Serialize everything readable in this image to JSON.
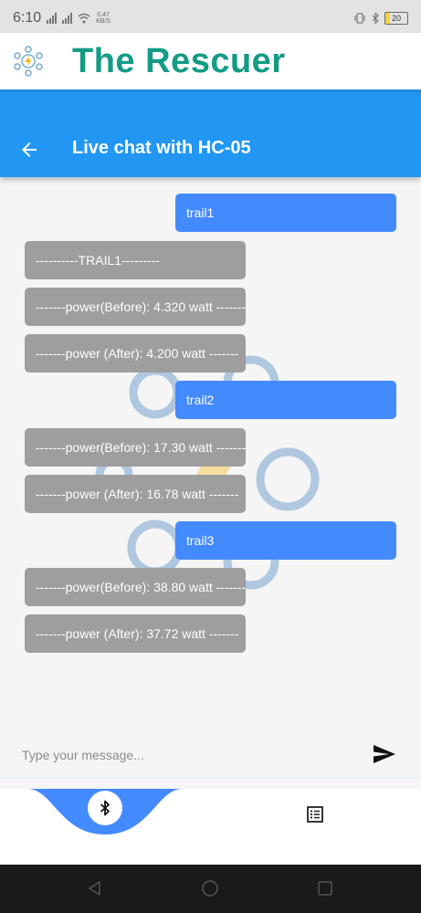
{
  "status_bar": {
    "time": "6:10",
    "network_speed_value": "0.47",
    "network_speed_unit": "KB/S",
    "battery": "20"
  },
  "app": {
    "title": "The Rescuer",
    "logo_icon": "bolt-network-logo-icon"
  },
  "chat_header": {
    "title": "Live chat with HC-05",
    "back_icon": "arrow-back-icon",
    "background": "#2196f3"
  },
  "messages": [
    {
      "side": "out",
      "text": "trail1"
    },
    {
      "side": "in",
      "text": "----------TRAIL1---------"
    },
    {
      "side": "in",
      "text": "-------power(Before): 4.320 watt -------"
    },
    {
      "side": "in",
      "text": "-------power (After): 4.200 watt -------"
    },
    {
      "side": "out",
      "text": "trail2"
    },
    {
      "side": "in",
      "text": "-------power(Before): 17.30 watt -------"
    },
    {
      "side": "in",
      "text": "-------power (After): 16.78 watt -------"
    },
    {
      "side": "out",
      "text": "trail3"
    },
    {
      "side": "in",
      "text": "-------power(Before): 38.80 watt -------"
    },
    {
      "side": "in",
      "text": "-------power (After): 37.72 watt -------"
    }
  ],
  "composer": {
    "placeholder": "Type your message...",
    "value": "",
    "send_icon": "send-icon"
  },
  "bottom_nav": {
    "items": [
      {
        "icon": "bluetooth-icon",
        "active": true
      },
      {
        "icon": "list-icon",
        "active": false
      }
    ],
    "accent": "#448aff"
  },
  "colors": {
    "outgoing_bubble": "#448aff",
    "incoming_bubble": "#9e9e9e",
    "title": "#139b85"
  }
}
